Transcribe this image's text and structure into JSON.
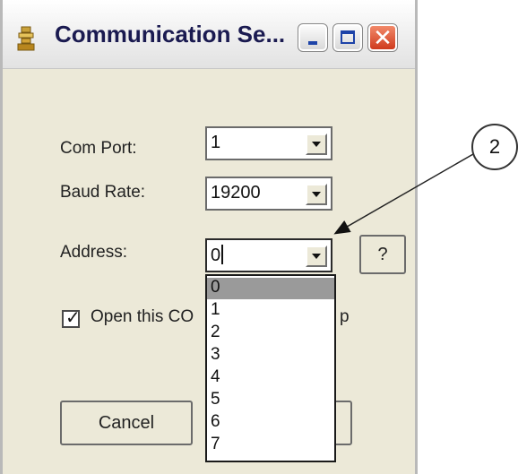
{
  "window": {
    "title": "Communication Se...",
    "app_icon": "serial-port-icon",
    "controls": {
      "minimize_icon": "minimize-icon",
      "maximize_icon": "maximize-icon",
      "close_icon": "close-icon",
      "close_glyph": "✕"
    }
  },
  "form": {
    "com_port": {
      "label": "Com Port:",
      "value": "1"
    },
    "baud_rate": {
      "label": "Baud Rate:",
      "value": "19200"
    },
    "address": {
      "label": "Address:",
      "value": "0",
      "options": [
        "0",
        "1",
        "2",
        "3",
        "4",
        "5",
        "6",
        "7"
      ],
      "selected_index": 0
    },
    "help_label": "?",
    "open_checkbox": {
      "checked": true,
      "label_left": "Open this CO",
      "label_right": "p"
    },
    "cancel_label": "Cancel",
    "ok_label": ""
  },
  "annotation": {
    "label": "2"
  },
  "colors": {
    "dialog_bg": "#ece9d8",
    "close_button": "#cf3a1d",
    "selection": "#9a9a9a"
  }
}
